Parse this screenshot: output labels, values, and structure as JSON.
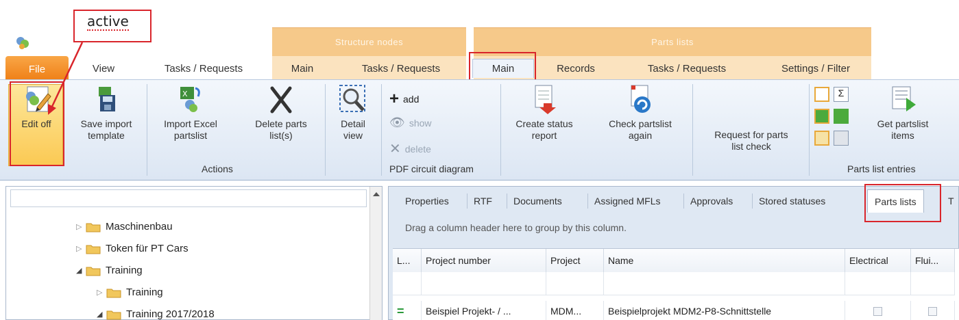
{
  "annotation": {
    "text": "active"
  },
  "context_headers": {
    "structure": "Structure nodes",
    "parts": "Parts lists"
  },
  "tabs": {
    "file": "File",
    "view": "View",
    "tasks1": "Tasks / Requests",
    "main1": "Main",
    "tasks2": "Tasks / Requests",
    "main2": "Main",
    "records": "Records",
    "tasks3": "Tasks / Requests",
    "settings": "Settings / Filter"
  },
  "ribbon": {
    "edit_off": "Edit off",
    "save_import_1": "Save import",
    "save_import_2": "template",
    "import_excel_1": "Import Excel",
    "import_excel_2": "partslist",
    "delete_parts_1": "Delete parts",
    "delete_parts_2": "list(s)",
    "detail_1": "Detail",
    "detail_2": "view",
    "actions_label": "Actions",
    "add": "add",
    "show": "show",
    "delete": "delete",
    "pdf_label": "PDF circuit diagram",
    "create_status_1": "Create status",
    "create_status_2": "report",
    "check_partslist_1": "Check partslist",
    "check_partslist_2": "again",
    "request_check_1": "Request for parts",
    "request_check_2": "list check",
    "get_items_1": "Get partslist",
    "get_items_2": "items",
    "entries_label": "Parts list entries"
  },
  "tree": {
    "items": [
      {
        "label": "Maschinenbau",
        "expander": "▷"
      },
      {
        "label": "Token für PT Cars",
        "expander": "▷"
      },
      {
        "label": "Training",
        "expander": "◢"
      },
      {
        "label": "Training",
        "expander": "▷"
      },
      {
        "label": "Training 2017/2018",
        "expander": "◢"
      }
    ]
  },
  "detail_tabs": [
    "Properties",
    "RTF",
    "Documents",
    "Assigned MFLs",
    "Approvals",
    "Stored statuses",
    "Parts lists",
    "T"
  ],
  "group_hint": "Drag a column header here to group by this column.",
  "grid": {
    "headers": [
      "L...",
      "Project number",
      "Project",
      "Name",
      "Electrical",
      "Flui..."
    ],
    "row": {
      "status": "=",
      "project_number": "Beispiel Projekt- / ...",
      "project": "MDM...",
      "name": "Beispielprojekt MDM2-P8-Schnittstelle"
    }
  },
  "colors": {
    "file_tab": "#ee7d14",
    "context": "#f6c98a",
    "highlight": "#d9252b",
    "ribbon": "#dce6f3"
  }
}
